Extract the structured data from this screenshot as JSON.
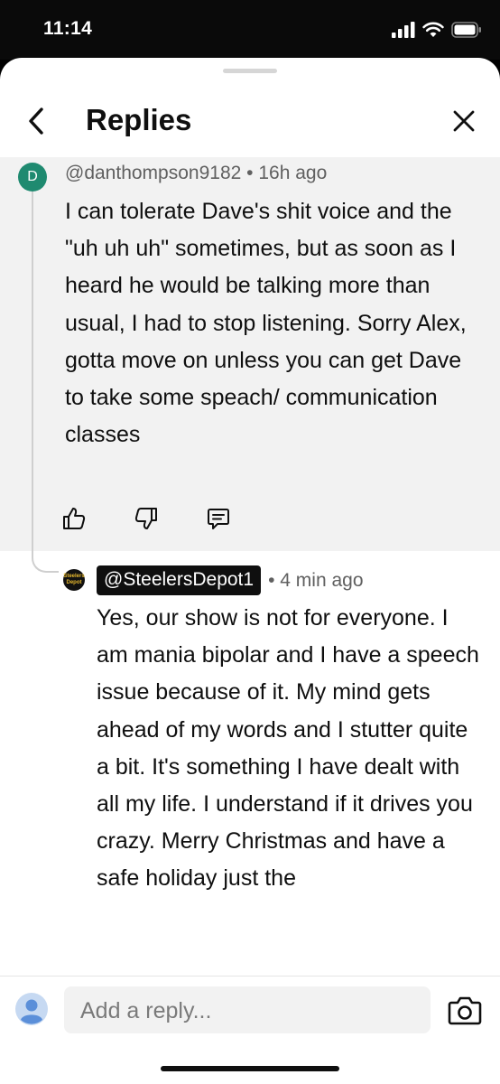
{
  "status_bar": {
    "time": "11:14"
  },
  "header": {
    "title": "Replies"
  },
  "parent_comment": {
    "avatar_letter": "D",
    "author": "@danthompson9182",
    "separator": "•",
    "time": "16h ago",
    "text": "I can tolerate Dave's shit voice and the \"uh uh uh\" sometimes, but as soon as I heard he would be talking more than usual, I had to stop listening. Sorry Alex, gotta move on unless you can get Dave to take some speach/ communication classes"
  },
  "reply": {
    "avatar_text": "Steelers Depot",
    "author": "@SteelersDepot1",
    "separator": "•",
    "time": "4 min ago",
    "text": "Yes, our show is not for everyone. I am mania bipolar and I have a speech issue because of it. My mind gets ahead of my words and I stutter quite a bit. It's something I have dealt with all my life. I understand if it drives you crazy. Merry Christmas and have a safe holiday just the"
  },
  "reply_bar": {
    "placeholder": "Add a reply..."
  },
  "icons": [
    "back-arrow",
    "close",
    "thumbs-up",
    "thumbs-down",
    "comment",
    "user-avatar",
    "camera",
    "signal",
    "wifi",
    "battery"
  ],
  "colors": {
    "avatar_d": "#1f8a70",
    "parent_bg": "#f2f2f2",
    "handle_badge_bg": "#0f0f0f",
    "meta": "#606060"
  }
}
